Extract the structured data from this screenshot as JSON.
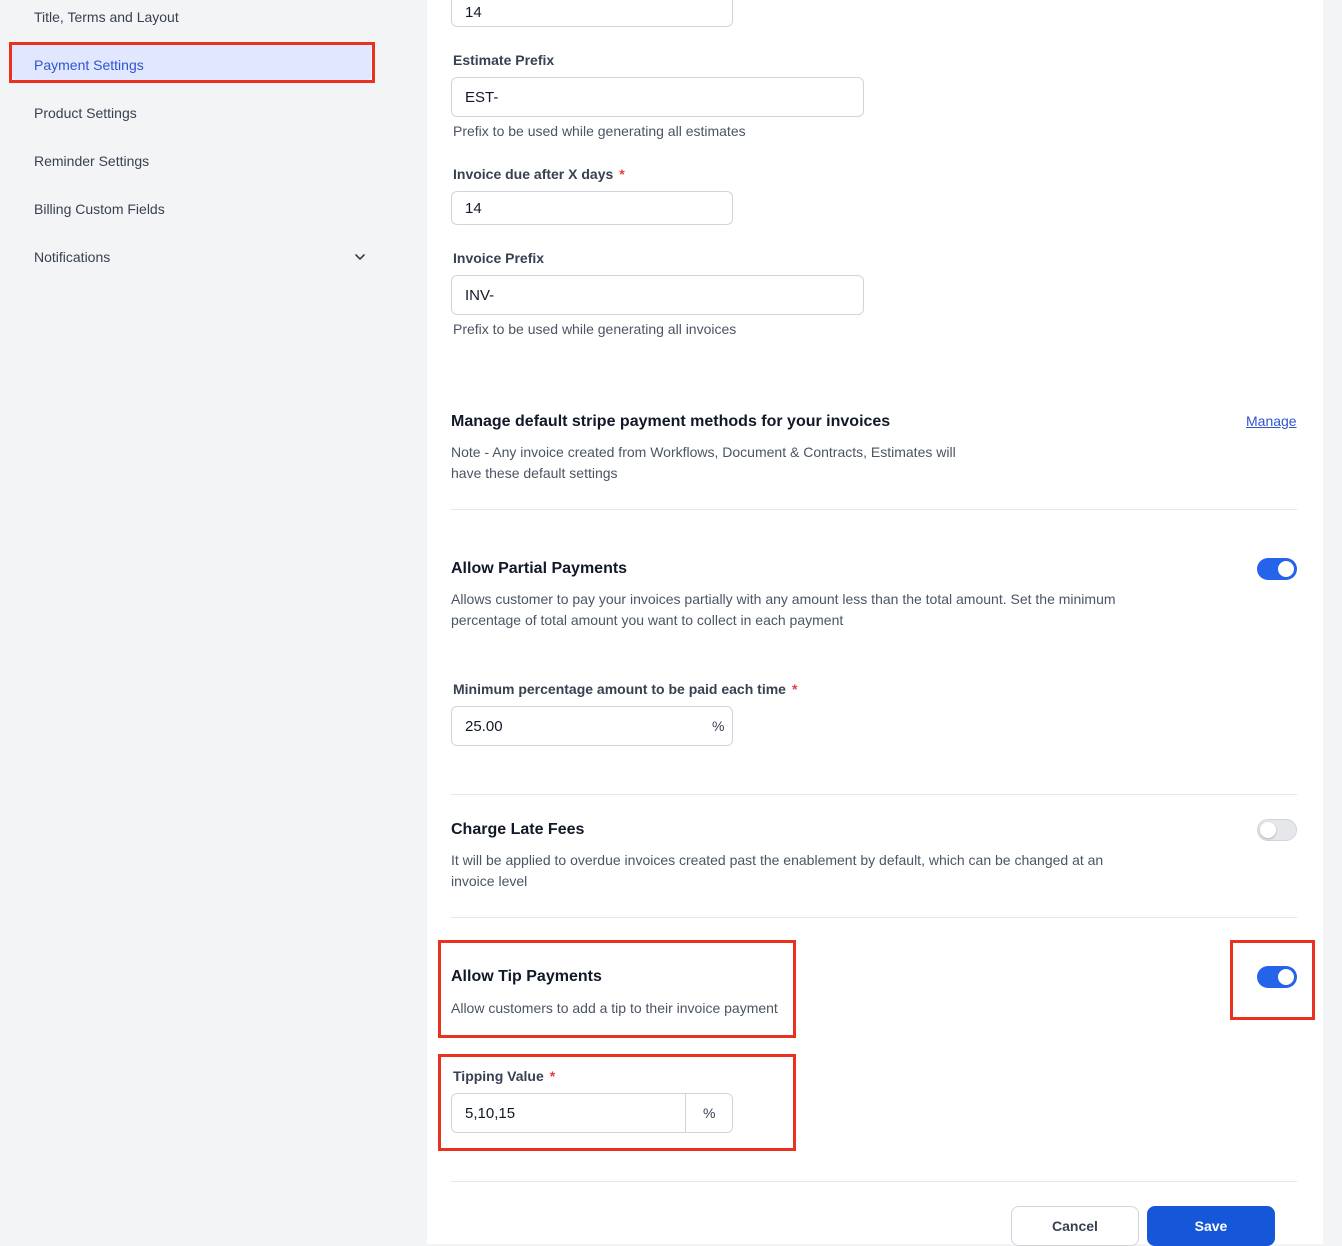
{
  "sidebar": {
    "items": [
      {
        "label": "Title, Terms and Layout"
      },
      {
        "label": "Payment Settings"
      },
      {
        "label": "Product Settings"
      },
      {
        "label": "Reminder Settings"
      },
      {
        "label": "Billing Custom Fields"
      },
      {
        "label": "Notifications"
      }
    ]
  },
  "fields": {
    "top_value": "14",
    "estimate_prefix": {
      "label": "Estimate Prefix",
      "value": "EST-",
      "help": "Prefix to be used while generating all estimates"
    },
    "invoice_due": {
      "label": "Invoice due after X days",
      "required": "*",
      "value": "14"
    },
    "invoice_prefix": {
      "label": "Invoice Prefix",
      "value": "INV-",
      "help": "Prefix to be used while generating all invoices"
    }
  },
  "stripe": {
    "title": "Manage default stripe payment methods for your invoices",
    "desc_line1": "Note - Any invoice created from Workflows, Document & Contracts, Estimates will",
    "desc_line2": "have these default settings",
    "link": "Manage"
  },
  "partial": {
    "title": "Allow Partial Payments",
    "desc_line1": "Allows customer to pay your invoices partially with any amount less than the total amount. Set the minimum",
    "desc_line2": "percentage of total amount you want to collect in each payment",
    "enabled": true,
    "min_label": "Minimum percentage amount to be paid each time",
    "required": "*",
    "min_value": "25.00",
    "suffix": "%"
  },
  "late_fees": {
    "title": "Charge Late Fees",
    "desc_line1": "It will be applied to overdue invoices created past the enablement by default, which can be changed at an",
    "desc_line2": "invoice level",
    "enabled": false
  },
  "tip": {
    "title": "Allow Tip Payments",
    "desc": "Allow customers to add a tip to their invoice payment",
    "enabled": true,
    "value_label": "Tipping Value",
    "required": "*",
    "value": "5,10,15",
    "suffix": "%"
  },
  "actions": {
    "cancel": "Cancel",
    "save": "Save"
  },
  "colors": {
    "accent": "#2563eb",
    "highlight": "#e8311f"
  }
}
